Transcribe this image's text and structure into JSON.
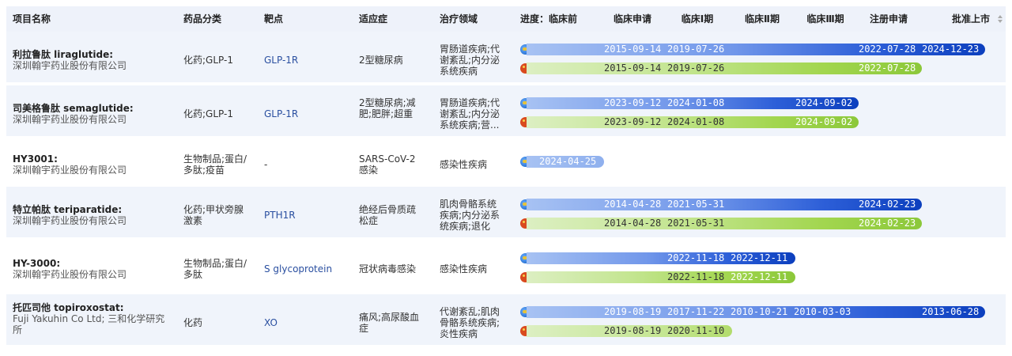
{
  "header": {
    "name": "项目名称",
    "category": "药品分类",
    "target": "靶点",
    "indication": "适应症",
    "therapy_area": "治疗领域",
    "stages": [
      "进度：临床前",
      "临床申请",
      "临床Ⅰ期",
      "临床Ⅱ期",
      "临床Ⅲ期",
      "注册申请",
      "批准上市"
    ]
  },
  "colors": {
    "global_bar": "#0c3fbe",
    "china_bar": "#8cc83a",
    "header_bg": "#eef2fa",
    "row_alt_bg": "#f0f4fb",
    "link": "#2a4fa0"
  },
  "icons": {
    "global": "globe-icon",
    "china": "china-flag-icon"
  },
  "rows": [
    {
      "name": "利拉鲁肽 liraglutide:",
      "org": "深圳翰宇药业股份有限公司",
      "category": "化药;GLP-1",
      "target": "GLP-1R",
      "indication": "2型糖尿病",
      "therapy": "胃肠道疾病;代谢紊乱;内分泌系统疾病",
      "global_dates": [
        "2015-09-14",
        "2019-07-26",
        "2022-07-28",
        "2024-12-23"
      ],
      "china_dates": [
        "2015-09-14",
        "2019-07-26",
        "2022-07-28"
      ]
    },
    {
      "name": "司美格鲁肽 semaglutide:",
      "org": "深圳翰宇药业股份有限公司",
      "category": "化药;GLP-1",
      "target": "GLP-1R",
      "indication": "2型糖尿病;减肥;肥胖;超重",
      "therapy": "胃肠道疾病;代谢紊乱;内分泌系统疾病;营...",
      "global_dates": [
        "2023-09-12",
        "2024-01-08",
        "2024-09-02"
      ],
      "china_dates": [
        "2023-09-12",
        "2024-01-08",
        "2024-09-02"
      ]
    },
    {
      "name": "HY3001:",
      "org": "深圳翰宇药业股份有限公司",
      "category": "生物制品;蛋白/多肽;疫苗",
      "target": "-",
      "indication": "SARS-CoV-2感染",
      "therapy": "感染性疾病",
      "global_dates": [
        "2024-04-25"
      ],
      "china_dates": []
    },
    {
      "name": "特立帕肽 teriparatide:",
      "org": "深圳翰宇药业股份有限公司",
      "category": "化药;甲状旁腺激素",
      "target": "PTH1R",
      "indication": "绝经后骨质疏松症",
      "therapy": "肌肉骨骼系统疾病;内分泌系统疾病;退化",
      "global_dates": [
        "2014-04-28",
        "2021-05-31",
        "2024-02-23"
      ],
      "china_dates": [
        "2014-04-28",
        "2021-05-31",
        "2024-02-23"
      ]
    },
    {
      "name": "HY-3000:",
      "org": "深圳翰宇药业股份有限公司",
      "category": "生物制品;蛋白/多肽",
      "target": "S glycoprotein",
      "indication": "冠状病毒感染",
      "therapy": "感染性疾病",
      "global_dates": [
        "2022-11-18",
        "2022-12-11"
      ],
      "china_dates": [
        "2022-11-18",
        "2022-12-11"
      ]
    },
    {
      "name": "托匹司他 topiroxostat:",
      "org": "Fuji Yakuhin Co Ltd; 三和化学研究所",
      "category": "化药",
      "target": "XO",
      "indication": "痛风;高尿酸血症",
      "therapy": "代谢紊乱;肌肉骨骼系统疾病;炎性疾病",
      "global_dates": [
        "2019-08-19",
        "2017-11-22",
        "2010-10-21",
        "2010-03-03",
        "2013-06-28"
      ],
      "china_dates": [
        "2019-08-19",
        "2020-11-10"
      ]
    }
  ]
}
